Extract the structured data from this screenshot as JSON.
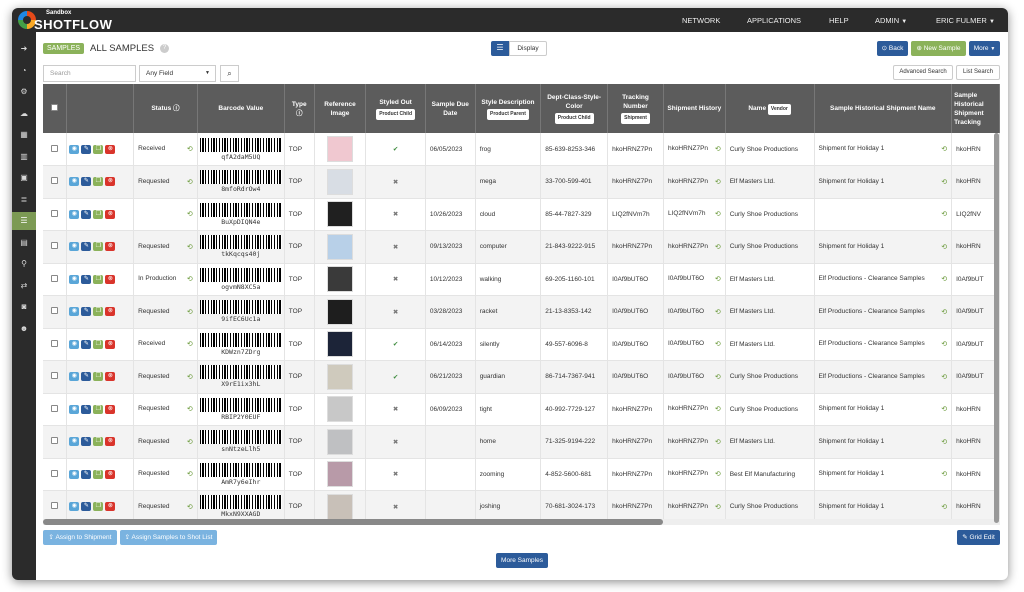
{
  "brand": {
    "env": "Sandbox",
    "name": "SHOTFLOW"
  },
  "nav": {
    "network": "NETWORK",
    "applications": "APPLICATIONS",
    "help": "HELP",
    "admin": "ADMIN",
    "user": "ERIC FULMER"
  },
  "sidebar_icons": [
    "arrow-right-icon",
    "dashboard-icon",
    "settings-icon",
    "cloud-upload-icon",
    "calendar-icon",
    "bar-chart-icon",
    "briefcase-icon",
    "database-icon",
    "list-icon",
    "file-icon",
    "sitemap-icon",
    "exchange-icon",
    "camera-icon",
    "users-icon"
  ],
  "page": {
    "tag": "SAMPLES",
    "title": "ALL SAMPLES",
    "help": "?"
  },
  "toolbar": {
    "display": "Display",
    "back": "Back",
    "new_sample": "New Sample",
    "more": "More"
  },
  "search": {
    "placeholder": "Search",
    "field": "Any Field",
    "advanced": "Advanced Search",
    "list": "List Search"
  },
  "columns": {
    "status": "Status",
    "barcode": "Barcode Value",
    "type": "Type",
    "ref": "Reference Image",
    "styled_out": "Styled Out",
    "styled_out_pill": "Product Child",
    "due": "Sample Due Date",
    "style_desc": "Style Description",
    "style_desc_pill": "Product Parent",
    "dept": "Dept-Class-Style-Color",
    "dept_pill": "Product Child",
    "tracking": "Tracking Number",
    "tracking_pill": "Shipment",
    "ship_hist": "Shipment History",
    "name": "Name",
    "name_pill": "Vendor",
    "hist_ship": "Sample Historical Shipment Name",
    "hist_track": "Sample Historical Shipment Tracking"
  },
  "rows": [
    {
      "status": "Received",
      "barcode": "qfA2daM5UQ",
      "type": "TOP",
      "styled": "check",
      "due": "06/05/2023",
      "desc": "frog",
      "dept": "85-639-8253-346",
      "track": "hkoHRNZ7Pn",
      "hist": "hkoHRNZ7Pn",
      "vendor": "Curly Shoe Productions",
      "shipname": "Shipment for Holiday 1",
      "histtrack": "hkoHRN"
    },
    {
      "status": "Requested",
      "barcode": "8mfoRdrOw4",
      "type": "TOP",
      "styled": "cross",
      "due": "",
      "desc": "mega",
      "dept": "33-700-599-401",
      "track": "hkoHRNZ7Pn",
      "hist": "hkoHRNZ7Pn",
      "vendor": "Elf Masters Ltd.",
      "shipname": "Shipment for Holiday 1",
      "histtrack": "hkoHRN"
    },
    {
      "status": "",
      "barcode": "BuXpDIQN4e",
      "type": "TOP",
      "styled": "cross",
      "due": "10/26/2023",
      "desc": "cloud",
      "dept": "85-44-7827-329",
      "track": "LIQ2fNVm7h",
      "hist": "LIQ2fNVm7h",
      "vendor": "Curly Shoe Productions",
      "shipname": "",
      "histtrack": "LIQ2fNV"
    },
    {
      "status": "Requested",
      "barcode": "tkKqcqs40j",
      "type": "TOP",
      "styled": "cross",
      "due": "09/13/2023",
      "desc": "computer",
      "dept": "21-843-9222-915",
      "track": "hkoHRNZ7Pn",
      "hist": "hkoHRNZ7Pn",
      "vendor": "Curly Shoe Productions",
      "shipname": "Shipment for Holiday 1",
      "histtrack": "hkoHRN"
    },
    {
      "status": "In Production",
      "barcode": "ogvmN8XC5a",
      "type": "TOP",
      "styled": "cross",
      "due": "10/12/2023",
      "desc": "walking",
      "dept": "69-205-1160-101",
      "track": "I0Af9bUT6O",
      "hist": "I0Af9bUT6O",
      "vendor": "Elf Masters Ltd.",
      "shipname": "Elf Productions - Clearance Samples",
      "histtrack": "I0Af9bUT"
    },
    {
      "status": "Requested",
      "barcode": "9ifEC6Uc1a",
      "type": "TOP",
      "styled": "cross",
      "due": "03/28/2023",
      "desc": "racket",
      "dept": "21-13-8353-142",
      "track": "I0Af9bUT6O",
      "hist": "I0Af9bUT6O",
      "vendor": "Elf Masters Ltd.",
      "shipname": "Elf Productions - Clearance Samples",
      "histtrack": "I0Af9bUT"
    },
    {
      "status": "Received",
      "barcode": "KDWzn7ZDrg",
      "type": "TOP",
      "styled": "check",
      "due": "06/14/2023",
      "desc": "silently",
      "dept": "49-557-6096-8",
      "track": "I0Af9bUT6O",
      "hist": "I0Af9bUT6O",
      "vendor": "Elf Masters Ltd.",
      "shipname": "Elf Productions - Clearance Samples",
      "histtrack": "I0Af9bUT"
    },
    {
      "status": "Requested",
      "barcode": "X9rE1ix3hL",
      "type": "TOP",
      "styled": "check",
      "due": "06/21/2023",
      "desc": "guardian",
      "dept": "86-714-7367-941",
      "track": "I0Af9bUT6O",
      "hist": "I0Af9bUT6O",
      "vendor": "Curly Shoe Productions",
      "shipname": "Elf Productions - Clearance Samples",
      "histtrack": "I0Af9bUT"
    },
    {
      "status": "Requested",
      "barcode": "RBIP2Y0EUF",
      "type": "TOP",
      "styled": "cross",
      "due": "06/09/2023",
      "desc": "tight",
      "dept": "40-992-7729-127",
      "track": "hkoHRNZ7Pn",
      "hist": "hkoHRNZ7Pn",
      "vendor": "Curly Shoe Productions",
      "shipname": "Shipment for Holiday 1",
      "histtrack": "hkoHRN"
    },
    {
      "status": "Requested",
      "barcode": "snNtzeLlh5",
      "type": "TOP",
      "styled": "cross",
      "due": "",
      "desc": "home",
      "dept": "71-325-9194-222",
      "track": "hkoHRNZ7Pn",
      "hist": "hkoHRNZ7Pn",
      "vendor": "Elf Masters Ltd.",
      "shipname": "Shipment for Holiday 1",
      "histtrack": "hkoHRN"
    },
    {
      "status": "Requested",
      "barcode": "AmR7y6eIhr",
      "type": "TOP",
      "styled": "cross",
      "due": "",
      "desc": "zooming",
      "dept": "4-852-5600-681",
      "track": "hkoHRNZ7Pn",
      "hist": "hkoHRNZ7Pn",
      "vendor": "Best Elf Manufacturing",
      "shipname": "Shipment for Holiday 1",
      "histtrack": "hkoHRN"
    },
    {
      "status": "Requested",
      "barcode": "MkxN9XXAGD",
      "type": "TOP",
      "styled": "cross",
      "due": "",
      "desc": "joshing",
      "dept": "70-681-3024-173",
      "track": "hkoHRNZ7Pn",
      "hist": "hkoHRNZ7Pn",
      "vendor": "Curly Shoe Productions",
      "shipname": "Shipment for Holiday 1",
      "histtrack": "hkoHRN"
    }
  ],
  "thumb_colors": [
    "#f0c8d0",
    "#d8dde4",
    "#202020",
    "#b8d0e8",
    "#3a3a3a",
    "#1e1e1e",
    "#1c2438",
    "#cfcabd",
    "#c8c8c8",
    "#bfc0c2",
    "#b89aa8",
    "#c8c0b8"
  ],
  "bottom": {
    "assign_shipment": "Assign to Shipment",
    "assign_shotlist": "Assign Samples to Shot List",
    "grid_edit": "Grid Edit",
    "more_samples": "More Samples"
  },
  "colors": {
    "primary": "#2c5b9a",
    "success": "#8bb25a",
    "info": "#5aa6d8",
    "danger": "#d9342b",
    "dark": "#2b2b2b"
  }
}
